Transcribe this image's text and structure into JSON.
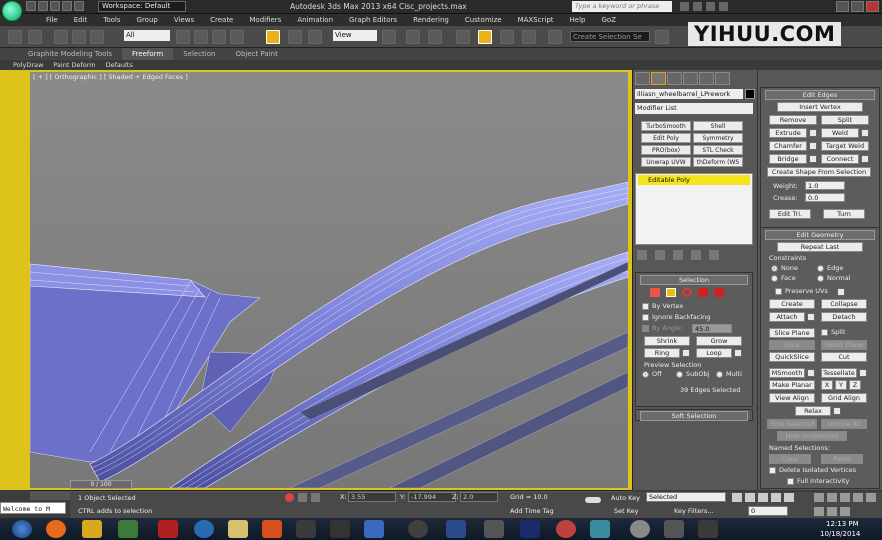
{
  "title_bar": {
    "workspace": "Workspace: Default",
    "app_title": "Autodesk 3ds Max 2013 x64    Cisc_projects.max",
    "search_placeholder": "Type a keyword or phrase"
  },
  "menu": [
    "File",
    "Edit",
    "Tools",
    "Group",
    "Views",
    "Create",
    "Modifiers",
    "Animation",
    "Graph Editors",
    "Rendering",
    "Customize",
    "MAXScript",
    "Help",
    "GoZ"
  ],
  "watermark": "YIHUU.COM",
  "toolbar": {
    "selection_filter": "All",
    "reference_coord": "View",
    "selection_set": "Create Selection Se"
  },
  "ribbon": {
    "tabs": [
      "Graphite Modeling Tools",
      "Freeform",
      "Selection",
      "Object Paint"
    ],
    "active_tab": "Freeform",
    "subtabs": [
      "PolyDraw",
      "Paint Deform",
      "Defaults"
    ]
  },
  "viewport": {
    "label": "[ + ] [ Orthographic ] [ Shaded + Edged Faces ]"
  },
  "command_panel": {
    "object_name": "illiasn_wheelbarrel_LPrework",
    "modifier_list": "Modifier List",
    "modifier_buttons": [
      "TurboSmooth",
      "Shell",
      "Edit Poly",
      "Symmetry",
      "PRO(box)",
      "STL Check",
      "Unwrap UVW",
      "thDeform (WS"
    ],
    "stack_item": "Editable Poly",
    "selection": {
      "title": "Selection",
      "by_vertex": "By Vertex",
      "ignore_backfacing": "Ignore Backfacing",
      "by_angle": "By Angle:",
      "angle_value": "45.0",
      "shrink": "Shrink",
      "grow": "Grow",
      "ring": "Ring",
      "loop": "Loop",
      "preview_selection": "Preview Selection",
      "off": "Off",
      "subobj": "SubObj",
      "multi": "Multi",
      "status": "39 Edges Selected"
    },
    "soft_selection": "Soft Selection"
  },
  "edit_edges": {
    "title": "Edit Edges",
    "insert_vertex": "Insert Vertex",
    "remove": "Remove",
    "split": "Split",
    "extrude": "Extrude",
    "weld": "Weld",
    "chamfer": "Chamfer",
    "target_weld": "Target Weld",
    "bridge": "Bridge",
    "connect": "Connect",
    "create_shape": "Create Shape From Selection",
    "weight_label": "Weight:",
    "weight_value": "1.0",
    "crease_label": "Crease:",
    "crease_value": "0.0",
    "edit_tri": "Edit Tri.",
    "turn": "Turn"
  },
  "edit_geometry": {
    "title": "Edit Geometry",
    "repeat_last": "Repeat Last",
    "constraints": "Constraints",
    "none": "None",
    "edge": "Edge",
    "face": "Face",
    "normal": "Normal",
    "preserve_uvs": "Preserve UVs",
    "create": "Create",
    "collapse": "Collapse",
    "attach": "Attach",
    "detach": "Detach",
    "slice_plane": "Slice Plane",
    "split": "Split",
    "slice": "Slice",
    "reset_plane": "Reset Plane",
    "quickslice": "QuickSlice",
    "cut": "Cut",
    "msmooth": "MSmooth",
    "tessellate": "Tessellate",
    "make_planar": "Make Planar",
    "x": "X",
    "y": "Y",
    "z": "Z",
    "view_align": "View Align",
    "grid_align": "Grid Align",
    "relax": "Relax",
    "hide_selected": "Hide Selected",
    "unhide_all": "Unhide All",
    "hide_unselected": "Hide Unselected",
    "named_selections": "Named Selections:",
    "copy": "Copy",
    "paste": "Paste",
    "delete_isolated": "Delete Isolated Vertices",
    "full_interactivity": "Full Interactivity"
  },
  "timeline": {
    "slider": "0 / 100"
  },
  "status": {
    "welcome": "Welcome to M",
    "objects_selected": "1 Object Selected",
    "prompt": "CTRL adds to selection",
    "x_label": "X:",
    "x_value": "3.55",
    "y_label": "Y:",
    "y_value": "-17.994",
    "z_label": "Z:",
    "z_value": "2.0",
    "grid": "Grid = 10.0",
    "add_time_tag": "Add Time Tag",
    "auto_key": "Auto Key",
    "selected": "Selected",
    "set_key": "Set Key",
    "key_filters": "Key Filters...",
    "frame": "0"
  },
  "taskbar": {
    "time": "12:13 PM",
    "date": "10/18/2014"
  }
}
